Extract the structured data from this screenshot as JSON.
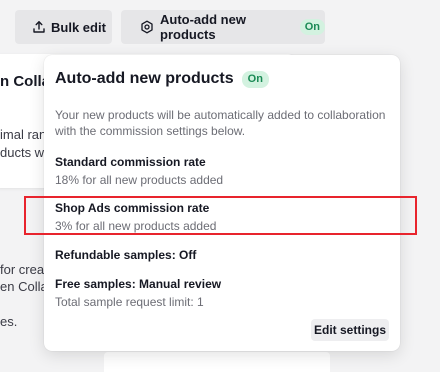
{
  "toolbar": {
    "bulk_edit_label": "Bulk edit",
    "auto_add_label": "Auto-add new products",
    "auto_add_status": "On",
    "bulk_edit_icon": "upload-icon",
    "auto_add_icon": "gear-icon"
  },
  "background": {
    "card_title_fragment": "n Collab",
    "card_line_1": "imal rang",
    "card_line_2": "ducts wil",
    "text_line_1": "for creato",
    "text_line_2": "en Collab",
    "text_line_3": "es."
  },
  "popover": {
    "title": "Auto-add new products",
    "status": "On",
    "description": "Your new products will be automatically added to collaboration with the commission settings below.",
    "standard": {
      "heading": "Standard commission rate",
      "value": "18% for all new products added"
    },
    "shop_ads": {
      "heading": "Shop Ads commission rate",
      "value": "3% for all new products added"
    },
    "refundable_samples": "Refundable samples: Off",
    "free_samples": {
      "heading": "Free samples: Manual review",
      "value": "Total sample request limit: 1"
    },
    "edit_button": "Edit settings"
  },
  "colors": {
    "status_green_bg": "#d3f2e0",
    "status_green_text": "#1b8a55",
    "highlight_red": "#e8242d"
  }
}
